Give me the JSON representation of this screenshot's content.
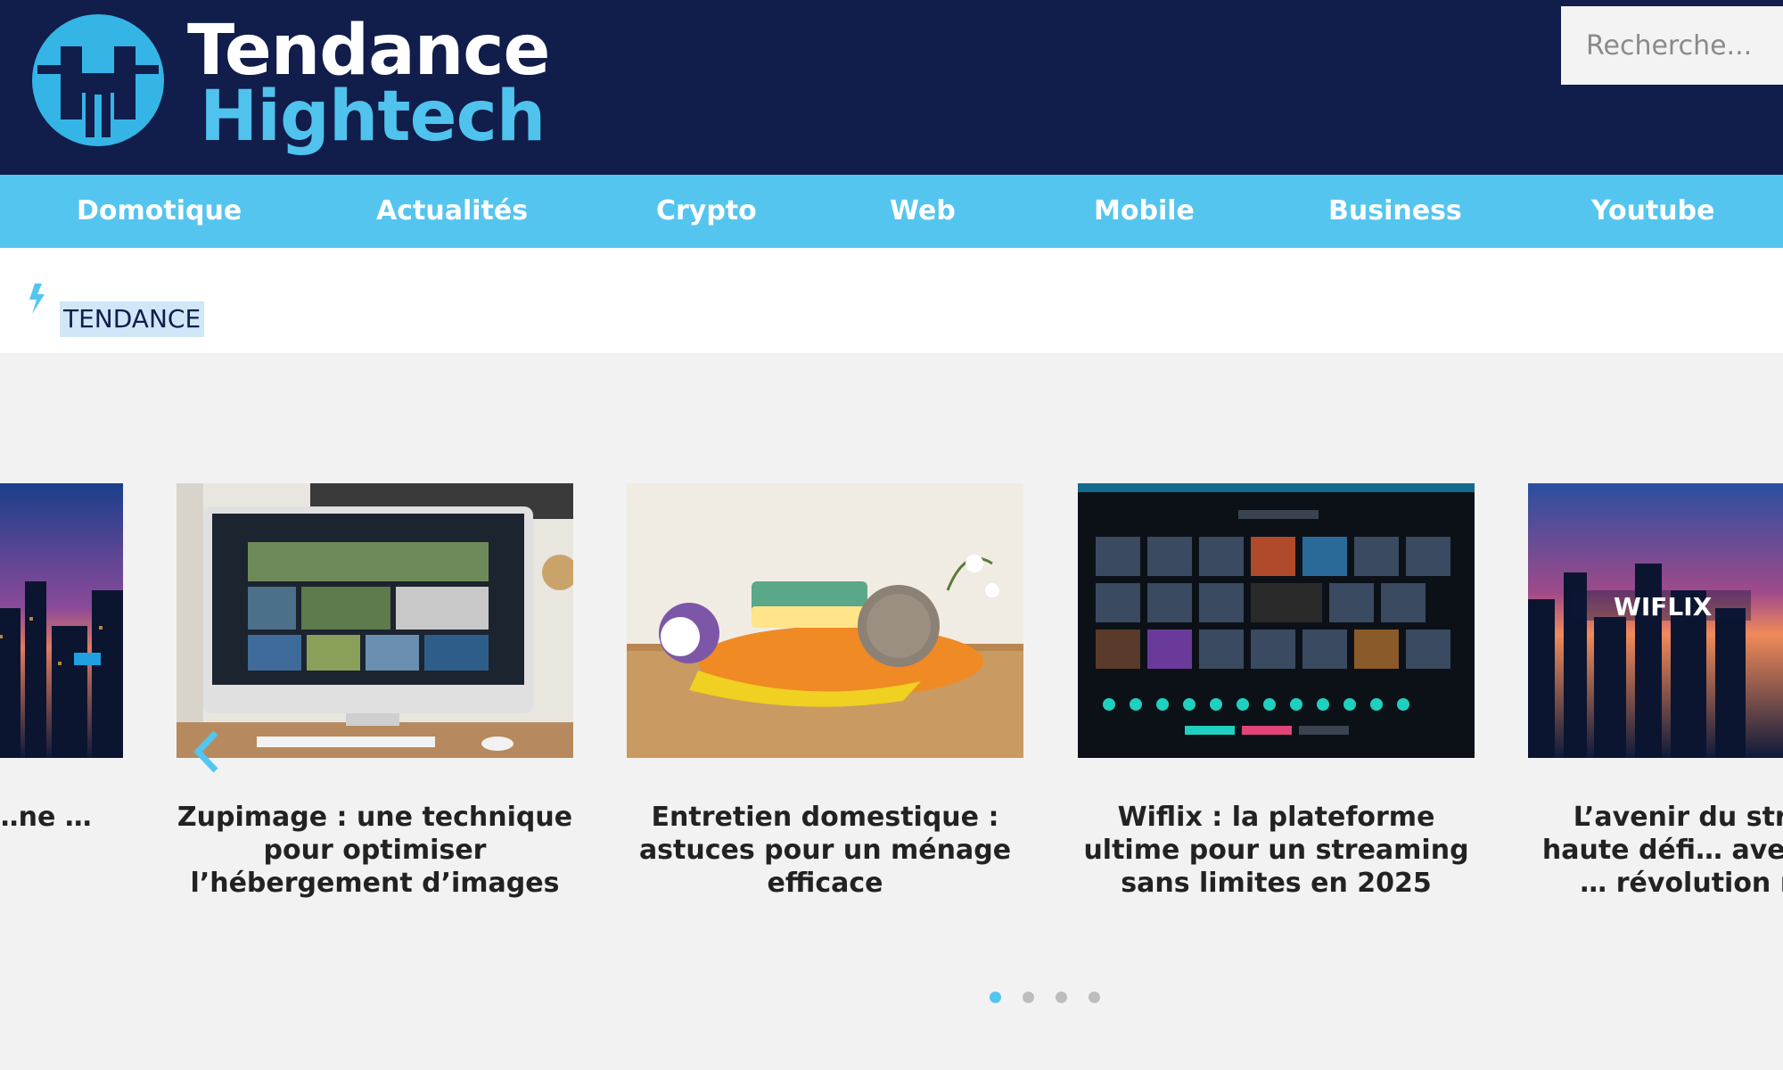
{
  "brand": {
    "name_line1": "Tendance",
    "name_line2": "Hightech",
    "accent_color": "#54c5ef",
    "header_color": "#111d4a"
  },
  "search": {
    "placeholder": "Recherche...",
    "value": ""
  },
  "nav": {
    "items": [
      {
        "label": "Domotique"
      },
      {
        "label": "Actualités"
      },
      {
        "label": "Crypto"
      },
      {
        "label": "Web"
      },
      {
        "label": "Mobile"
      },
      {
        "label": "Business"
      },
      {
        "label": "Youtube"
      }
    ]
  },
  "trending": {
    "label": "TENDANCE",
    "icon": "bolt-icon"
  },
  "carousel": {
    "prev_icon": "chevron-left-icon",
    "cards": [
      {
        "title": "…aming …ition …ne …érique",
        "image": "city-neon-skyline"
      },
      {
        "title": "Zupimage : une technique pour optimiser l’hébergement d’images",
        "image": "imac-photo-gallery"
      },
      {
        "title": "Entretien domestique : astuces pour un ménage efficace",
        "image": "cleaning-sponges"
      },
      {
        "title": "Wiflix : la plateforme ultime pour un streaming sans limites en 2025",
        "image": "streaming-dashboard"
      },
      {
        "title": "L’avenir du stre… en haute défi… avec wiflix : … révolution num…",
        "image": "wiflix-city-skyline"
      }
    ],
    "dots": {
      "count": 4,
      "active_index": 0
    }
  }
}
